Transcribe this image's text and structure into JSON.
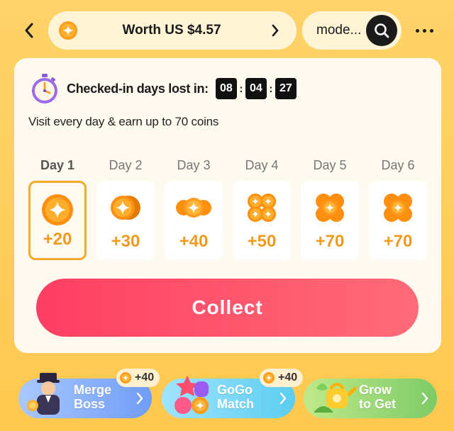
{
  "header": {
    "worth_label": "Worth US $4.57",
    "search_text": "mode..."
  },
  "checkin": {
    "lost_label": "Checked-in days lost in:",
    "countdown": {
      "h": "08",
      "m": "04",
      "s": "27"
    },
    "subtitle": "Visit every day & earn up to 70 coins"
  },
  "days": [
    {
      "label": "Day 1",
      "amount": "+20",
      "active": true,
      "icon": "single-coin-icon"
    },
    {
      "label": "Day 2",
      "amount": "+30",
      "active": false,
      "icon": "double-coin-icon"
    },
    {
      "label": "Day 3",
      "amount": "+40",
      "active": false,
      "icon": "triple-coin-icon"
    },
    {
      "label": "Day 4",
      "amount": "+50",
      "active": false,
      "icon": "coin-stack-icon"
    },
    {
      "label": "Day 5",
      "amount": "+70",
      "active": false,
      "icon": "coin-pile-icon"
    },
    {
      "label": "Day 6",
      "amount": "+70",
      "active": false,
      "icon": "coin-pile-icon"
    }
  ],
  "collect_label": "Collect",
  "games": [
    {
      "title_line1": "Merge",
      "title_line2": "Boss",
      "badge": "+40"
    },
    {
      "title_line1": "GoGo",
      "title_line2": "Match",
      "badge": "+40"
    },
    {
      "title_line1": "Grow",
      "title_line2": "to Get",
      "badge": ""
    }
  ],
  "colors": {
    "background": "#ffc84f",
    "collect_button": "#ff4a66",
    "coin_amount": "#f29a1d",
    "active_day_border": "#f7a92b"
  }
}
